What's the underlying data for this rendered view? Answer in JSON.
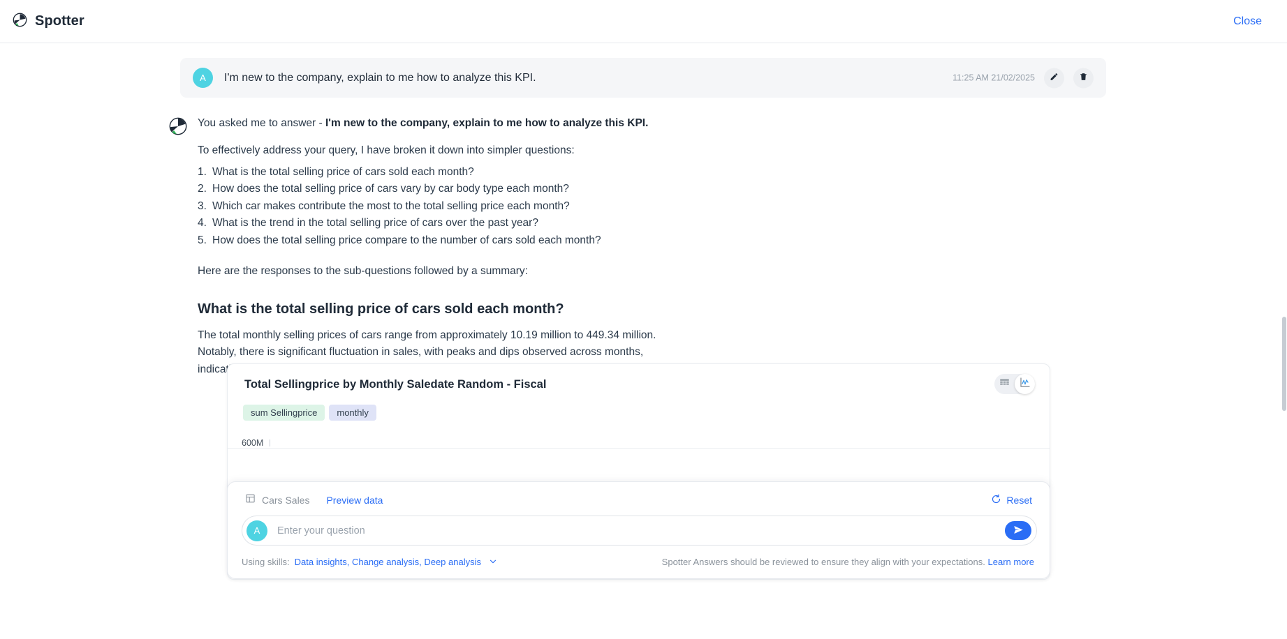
{
  "header": {
    "title": "Spotter",
    "logo_icon": "spotter-logo-icon",
    "close_label": "Close"
  },
  "conversation": {
    "user_message": {
      "avatar_initial": "A",
      "text": "I'm new to the company, explain to me how to analyze this KPI.",
      "timestamp": "11:25 AM 21/02/2025",
      "edit_icon": "pencil-icon",
      "delete_icon": "trash-icon"
    },
    "assistant": {
      "intro_prefix": "You asked me to answer - ",
      "intro_question": "I'm new to the company, explain to me how to analyze this KPI.",
      "breakdown_line": "To effectively address your query, I have broken it down into simpler questions:",
      "sub_questions": [
        "What is the total selling price of cars sold each month?",
        "How does the total selling price of cars vary by car body type each month?",
        "Which car makes contribute the most to the total selling price each month?",
        "What is the trend in the total selling price of cars over the past year?",
        "How does the total selling price compare to the number of cars sold each month?"
      ],
      "responses_line": "Here are the responses to the sub-questions followed by a summary:",
      "section_heading": "What is the total selling price of cars sold each month?",
      "description": [
        "The total monthly selling prices of cars range from approximately 10.19 million to 449.34 million.",
        "Notably, there is significant fluctuation in sales, with peaks and dips observed across months,",
        "indicating variability in demand or market conditions."
      ]
    }
  },
  "viz_card": {
    "title": "Total Sellingprice by Monthly Saledate Random - Fiscal",
    "pills": [
      {
        "label": "sum Sellingprice",
        "kind": "measure"
      },
      {
        "label": "monthly",
        "kind": "attribute"
      }
    ],
    "view_toggle": {
      "table_icon": "table-view-icon",
      "chart_icon": "chart-view-icon",
      "selected": "chart"
    }
  },
  "chart_data": {
    "type": "line",
    "title": "Total Sellingprice by Monthly Saledate Random - Fiscal",
    "xlabel": "monthly",
    "ylabel": "sum Sellingprice",
    "tick_labels": [
      "600M"
    ],
    "ylim": [
      0,
      600000000
    ],
    "value_min_label": "10.19 million",
    "value_max_label": "449.34 million",
    "grid": false,
    "legend": "none",
    "note": "Chart plot area is occluded by the question input panel; only the 600M axis tick is visible."
  },
  "input_panel": {
    "source_icon": "table-icon",
    "source_name": "Cars Sales",
    "preview_link": "Preview data",
    "reset_icon": "refresh-icon",
    "reset_label": "Reset",
    "avatar_initial": "A",
    "question_value": "",
    "question_placeholder": "Enter your question",
    "send_icon": "send-icon",
    "skills_label": "Using skills:",
    "skills_value": "Data insights, Change analysis, Deep analysis",
    "skills_chevron": "chevron-down-icon",
    "disclaimer": "Spotter Answers should be reviewed to ensure they align with your expectations.",
    "learn_more": "Learn more"
  },
  "colors": {
    "accent_blue": "#2a6df5",
    "avatar_cyan": "#4ed3e2",
    "measure_pill": "#ddf4e7",
    "attribute_pill": "#dfe3f7",
    "text_primary": "#1f2a37",
    "text_muted": "#8a929b"
  }
}
